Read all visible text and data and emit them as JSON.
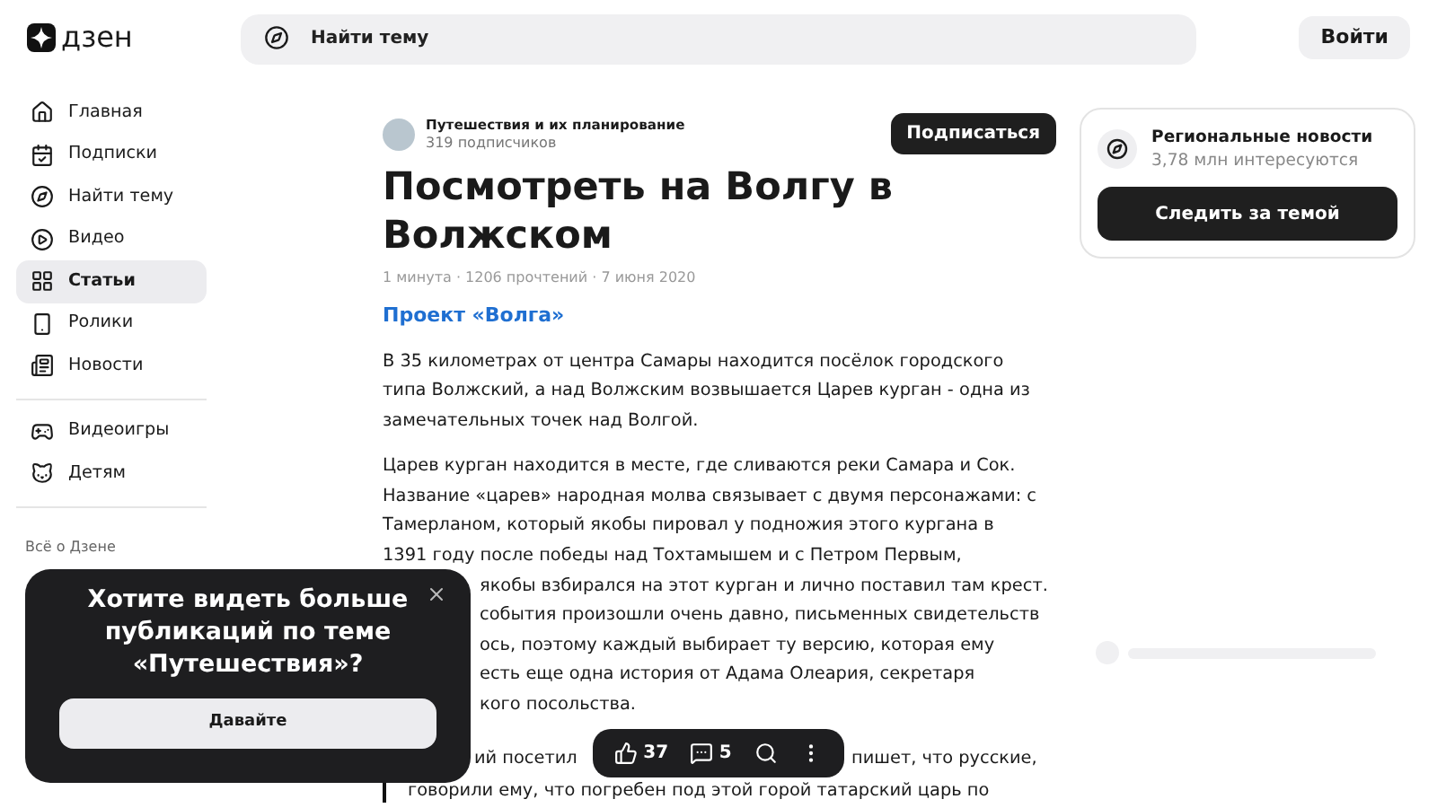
{
  "header": {
    "logo": "дзен",
    "search": {
      "placeholder": "Найти тему"
    },
    "login": "Войти"
  },
  "sidebar": {
    "groups": [
      {
        "items": [
          {
            "kind": "home",
            "label": "Главная",
            "selected": false
          },
          {
            "kind": "subscriptions",
            "label": "Подписки",
            "selected": false
          },
          {
            "kind": "topics",
            "label": "Найти тему",
            "selected": false
          },
          {
            "kind": "video",
            "label": "Видео",
            "selected": false
          },
          {
            "kind": "articles",
            "label": "Статьи",
            "selected": true
          },
          {
            "kind": "shorts",
            "label": "Ролики",
            "selected": false
          },
          {
            "kind": "news",
            "label": "Новости",
            "selected": false
          }
        ]
      },
      {
        "items": [
          {
            "kind": "games",
            "label": "Видеоигры",
            "selected": false
          },
          {
            "kind": "kids",
            "label": "Детям",
            "selected": false
          }
        ]
      }
    ],
    "footer": "Всё о Дзене"
  },
  "article": {
    "channel": {
      "name": "Путешествия и их планирование",
      "subscribers": "319 подписчиков",
      "subscribe": "Подписаться"
    },
    "title": "Посмотреть на Волгу в Волжском",
    "meta": "1 минута · 1206 прочтений · 7 июня 2020",
    "link": "Проект «Волга»",
    "paragraphs": [
      {
        "lines": [
          {
            "text": "В 35 километрах от центра Самары находится посёлок городского",
            "covered": false
          },
          {
            "text": "типа Волжский, а над Волжским возвышается Царев курган - одна из",
            "covered": false
          },
          {
            "text": "замечательных точек над Волгой.",
            "covered": false
          }
        ]
      },
      {
        "lines": [
          {
            "text": "Царев курган находится в месте, где сливаются реки Самара и Сок.",
            "covered": false
          },
          {
            "text": "Название «царев» народная молва связывает с двумя персонажами: с",
            "covered": false
          },
          {
            "text": "Тамерланом, который якобы пировал у подножия этого кургана в",
            "covered": false
          },
          {
            "text": "1391 году после победы над Тохтамышем и с Петром Первым,",
            "covered": false
          },
          {
            "text": "якобы взбирался на этот курган и лично поставил там крест.",
            "covered": true
          },
          {
            "text": "события произошли очень давно, письменных свидетельств",
            "covered": true
          },
          {
            "text": "ось, поэтому каждый выбирает ту версию, которая ему",
            "covered": true
          },
          {
            "text": "есть еще одна история от Адама Олеария, секретаря",
            "covered": true
          },
          {
            "text": "кого посольства.",
            "covered": true
          }
        ]
      }
    ],
    "quote": {
      "start": "ий посетил",
      "end": "пишет, что русские,",
      "line_2": "говорили ему, что погребен под этой горой татарский царь по"
    }
  },
  "actions": {
    "likes": "37",
    "comments": "5"
  },
  "topic_card": {
    "name": "Региональные новости",
    "followers": "3,78 млн интересуются",
    "follow": "Следить за темой"
  },
  "popup": {
    "title": "Хотите видеть больше публикаций по теме «Путешествия»?",
    "button": "Давайте"
  }
}
